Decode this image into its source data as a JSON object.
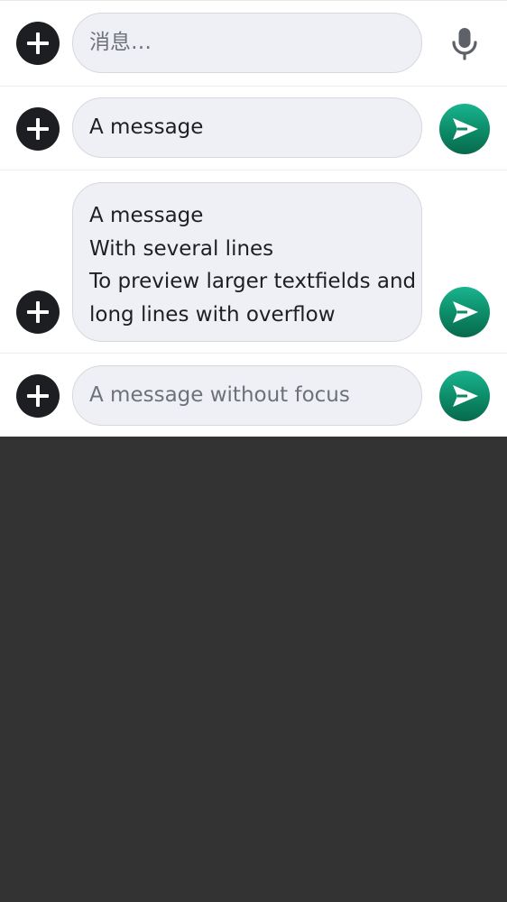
{
  "rows": [
    {
      "placeholder": "消息…",
      "icon": "microphone-icon"
    },
    {
      "value": "A message",
      "icon": "send-icon"
    },
    {
      "lines": [
        "A message",
        "With several lines",
        "To preview larger textfields and",
        "long lines with overflow"
      ],
      "icon": "send-icon"
    },
    {
      "placeholder": "A message without focus",
      "icon": "send-icon"
    }
  ],
  "colors": {
    "send_accent": "#13a27d",
    "add_button": "#1d1e22",
    "field_background": "#eff0f5",
    "backdrop": "#333333"
  }
}
